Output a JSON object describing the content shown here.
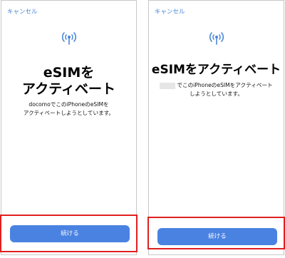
{
  "left_screen": {
    "cancel_label": "キャンセル",
    "title_line1": "eSIMを",
    "title_line2": "アクティベート",
    "desc_line1": "docomoでこのiPhoneのeSIMを",
    "desc_line2": "アクティベートしようとしています。",
    "continue_label": "続ける"
  },
  "right_screen": {
    "cancel_label": "キャンセル",
    "title": "eSIMをアクティベート",
    "desc_line1": "でこのiPhoneのeSIMをアクティベート",
    "desc_line2": "しようとしています。",
    "continue_label": "続ける"
  },
  "icons": {
    "esim": "antenna-signal-icon"
  },
  "colors": {
    "accent": "#4a82e2",
    "link": "#4a86d8",
    "highlight": "#e02020"
  }
}
